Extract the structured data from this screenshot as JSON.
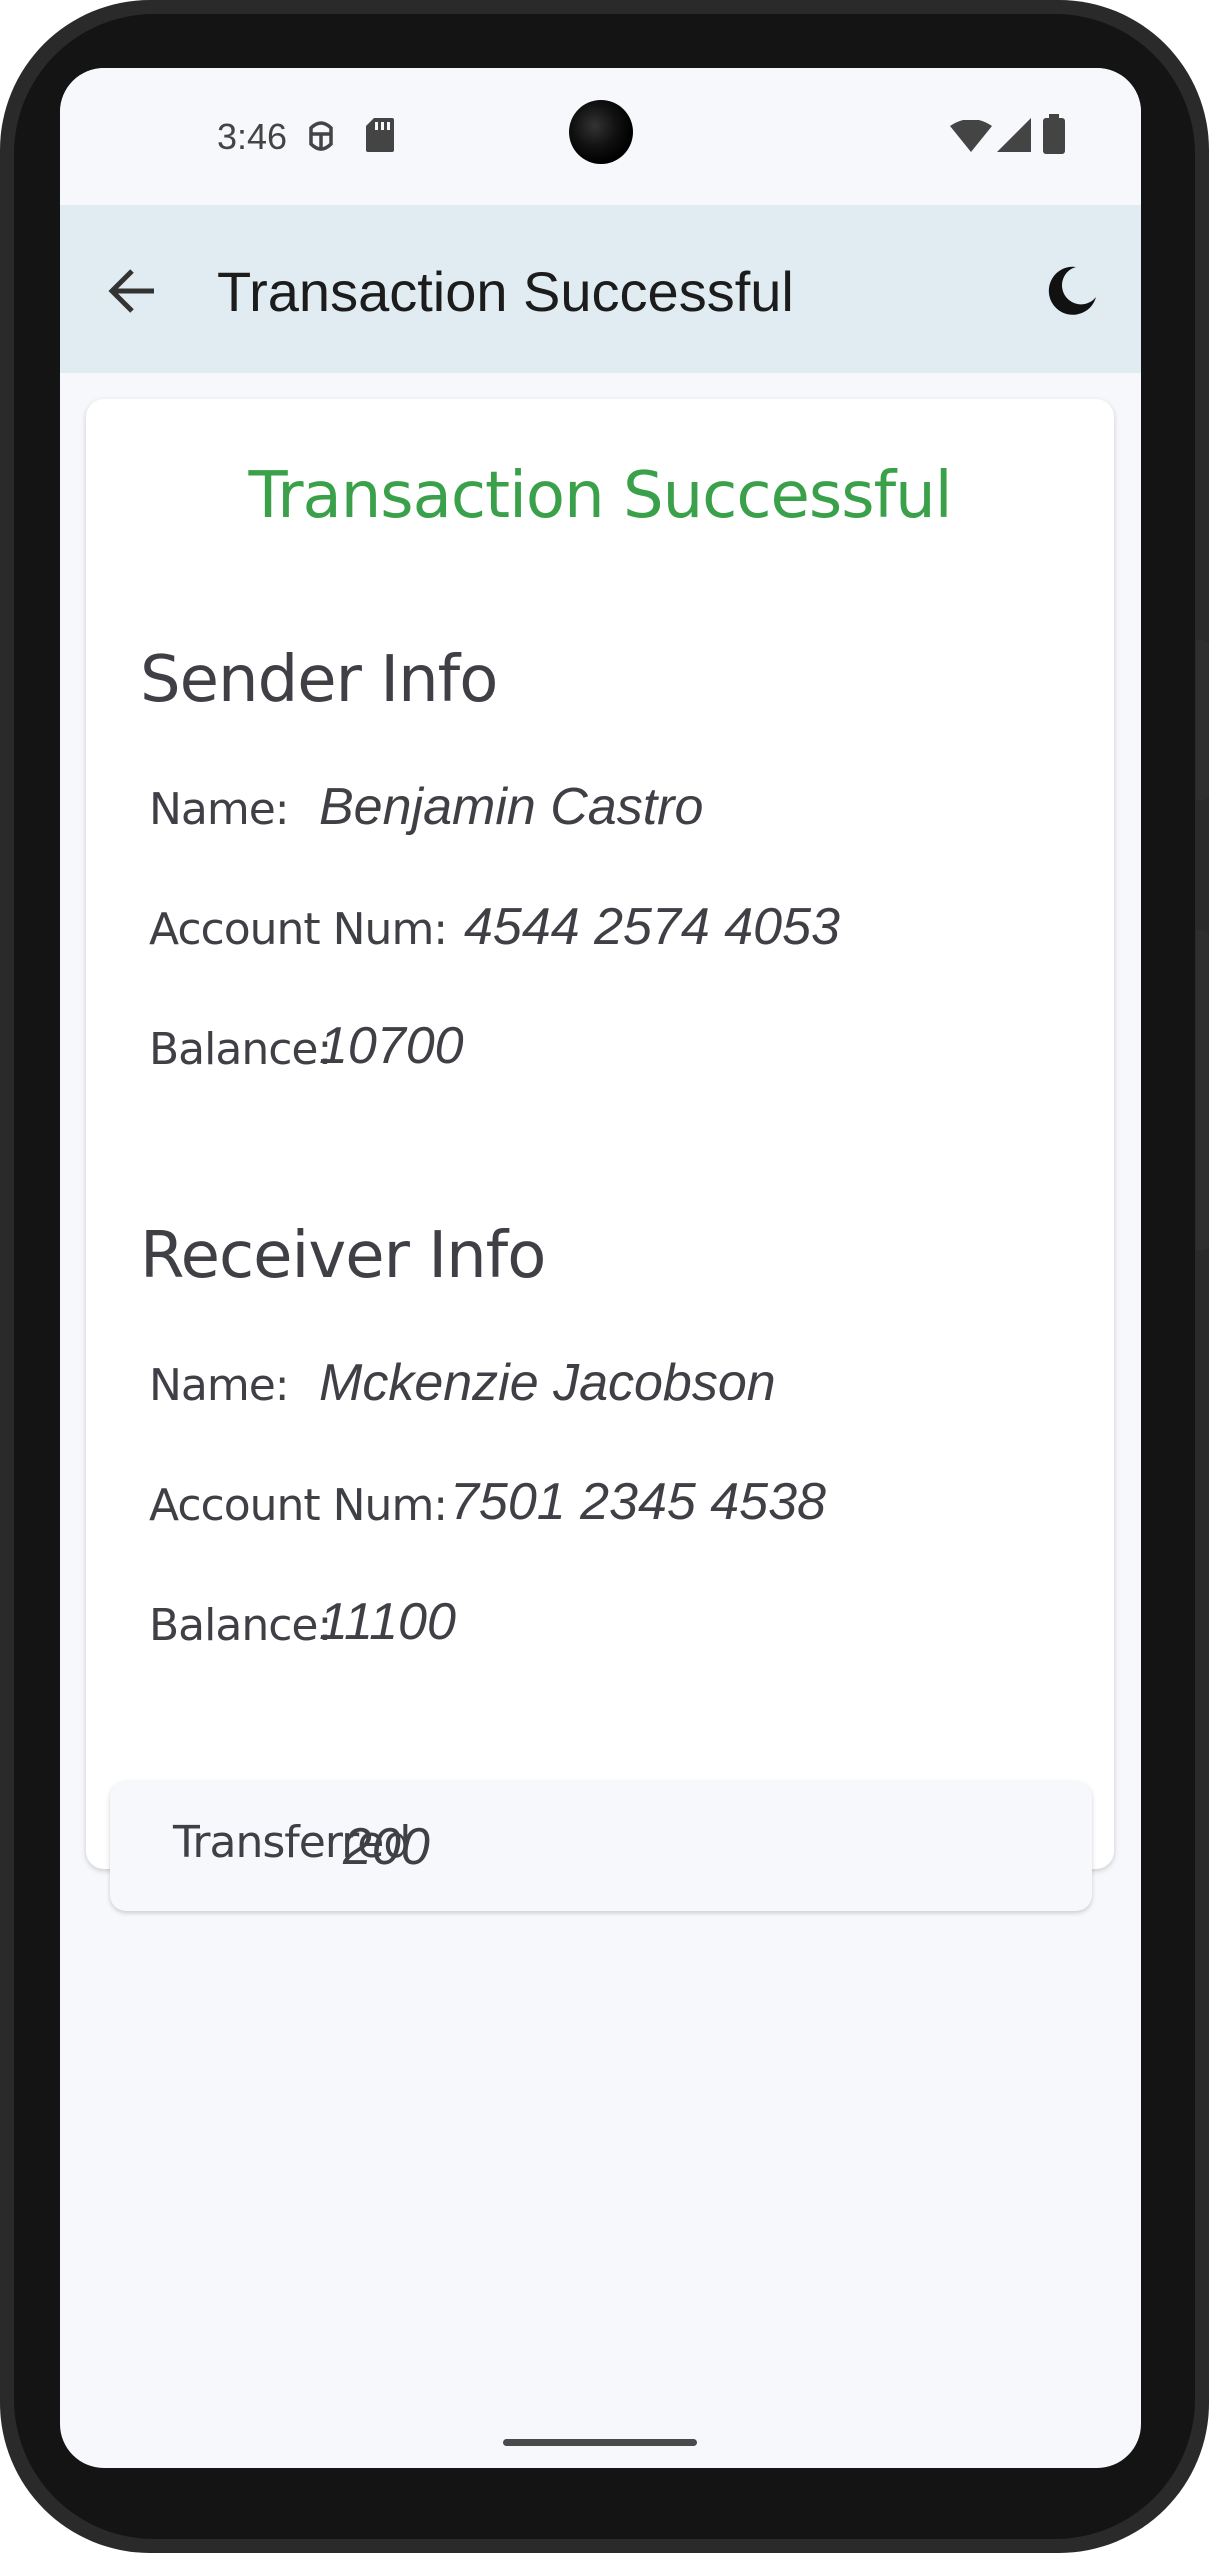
{
  "status_bar": {
    "time": "3:46",
    "icons": [
      "debug-icon",
      "sd-card-icon",
      "wifi-icon",
      "signal-icon",
      "battery-icon"
    ]
  },
  "app_bar": {
    "title": "Transaction Successful",
    "back_icon": "arrow-left-icon",
    "theme_icon": "moon-icon"
  },
  "card": {
    "title": "Transaction Successful",
    "title_color": "#3aa14a",
    "sender": {
      "heading": "Sender Info",
      "name_label": "Name:",
      "name": "Benjamin Castro",
      "account_label": "Account Num:",
      "account": "4544 2574 4053",
      "balance_label": "Balance:",
      "balance": "10700"
    },
    "receiver": {
      "heading": "Receiver Info",
      "name_label": "Name:",
      "name": "Mckenzie Jacobson",
      "account_label": "Account Num:",
      "account": "7501 2345 4538",
      "balance_label": "Balance:",
      "balance": "11100"
    },
    "transfer": {
      "label": "Transferred",
      "amount": "200"
    }
  },
  "colors": {
    "app_bar_bg": "#e1ecf2",
    "screen_bg": "#f6f8fc",
    "success_green": "#3aa14a",
    "text_dark": "#3f3f46"
  }
}
